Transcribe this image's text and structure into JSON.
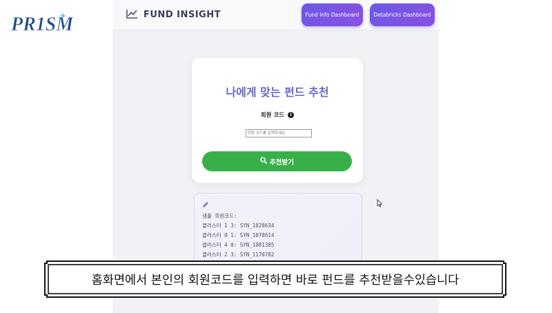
{
  "logo": {
    "text": "PR1SM"
  },
  "header": {
    "title": "FUND INSIGHT",
    "nav": [
      {
        "label": "Fund Info Dashboard"
      },
      {
        "label": "Databricks Dashboard"
      }
    ]
  },
  "form": {
    "title": "나에게 맞는 펀드 추천",
    "field_label": "회원 코드",
    "input_placeholder": "회원 코드를 입력하세요",
    "input_value": "",
    "submit_label": "추천받기"
  },
  "sample": {
    "heading": "샘플 회원코드:",
    "lines": [
      "클러스터 1 3: SYN_1028634",
      "클러스터 0 1: SYN_1078614",
      "클러스터 4 0: SYN_1081385",
      "클러스터 2 3: SYN_1170782"
    ]
  },
  "caption": "홈화면에서 본인의 회원코드를 입력하면 바로 펀드를 추천받을수있습니다",
  "colors": {
    "accent_purple": "#6668c8",
    "nav_gradient_start": "#6a5ae8",
    "nav_gradient_end": "#8a4fe0",
    "submit_green": "#38b04a",
    "logo_blue": "#1f4e8c"
  },
  "icons": {
    "brand": "line-chart-icon",
    "field_info": "info-icon",
    "submit": "search-icon",
    "sample": "pencil-icon"
  }
}
